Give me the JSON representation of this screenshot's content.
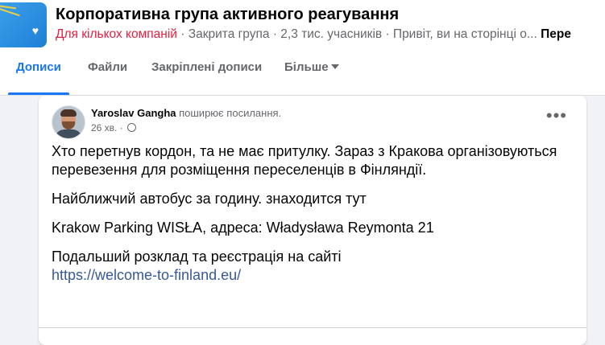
{
  "group": {
    "logo_text": "Корпоративна група активного реагування",
    "title": "Корпоративна група активного реагування",
    "badge": "Для кількох компаній",
    "privacy": "Закрита група",
    "members": "2,3 тис. учасників",
    "visit_note": "Привіт, ви на сторінці о...",
    "more": "Пере",
    "sep1": " · ",
    "sep2": " · ",
    "sep3": " · "
  },
  "tabs": [
    {
      "label": "Дописи",
      "active": true
    },
    {
      "label": "Файли"
    },
    {
      "label": "Закріплені дописи"
    },
    {
      "label": "Більше"
    }
  ],
  "post": {
    "author": "Yaroslav Gangha",
    "action": " поширює посилання.",
    "time": "26 хв.",
    "dot": " · ",
    "menu": "•••",
    "paragraphs": [
      "Хто перетнув кордон, та не має притулку. Зараз з Кракова організовуються перевезення для розміщення переселенців в Фінляндії.",
      "Найближчий автобус за годину. знаходится тут",
      "Krakow Parking WISŁA, адреса: Władysława Reymonta 21",
      "Подальший розклад та реєстрація на сайті"
    ],
    "link": "https://welcome-to-finland.eu/"
  },
  "colors": {
    "accent": "#1877f2",
    "badge": "#e41e3f",
    "link": "#385898"
  }
}
